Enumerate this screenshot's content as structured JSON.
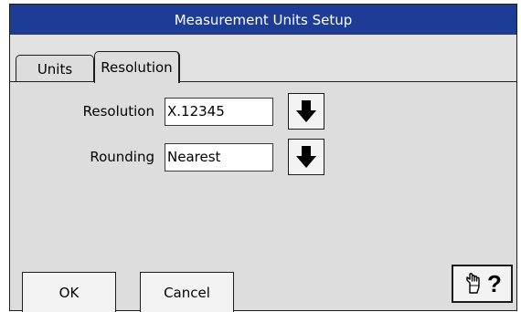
{
  "window": {
    "title": "Measurement Units Setup"
  },
  "tabs": [
    {
      "label": "Units",
      "active": false
    },
    {
      "label": "Resolution",
      "active": true
    }
  ],
  "form": {
    "resolution": {
      "label": "Resolution",
      "value": "X.12345",
      "button_icon": "down-arrow-icon"
    },
    "rounding": {
      "label": "Rounding",
      "value": "Nearest",
      "button_icon": "down-arrow-icon"
    }
  },
  "buttons": {
    "ok_label": "OK",
    "cancel_label": "Cancel",
    "help_icon": "hand-help-icon",
    "help_text": "?"
  },
  "colors": {
    "titlebar": "#1c3c96",
    "panel": "#dddddd"
  }
}
